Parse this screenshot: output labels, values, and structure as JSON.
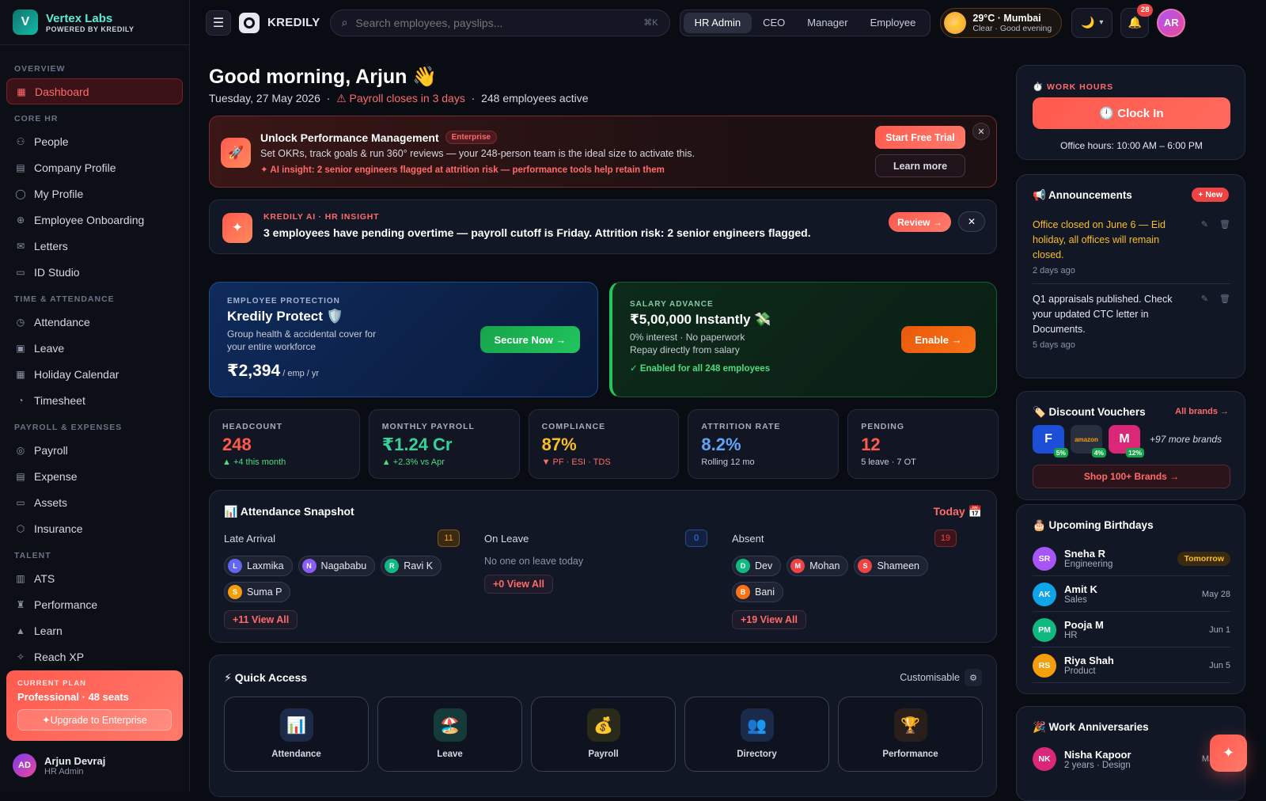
{
  "brand": {
    "initial": "V",
    "name": "Vertex Labs",
    "sub": "POWERED BY KREDILY"
  },
  "sidebar": {
    "sections": [
      {
        "title": "OVERVIEW",
        "items": [
          {
            "label": "Dashboard",
            "icon": "grid-icon",
            "active": true
          }
        ]
      },
      {
        "title": "CORE HR",
        "items": [
          {
            "label": "People",
            "icon": "users-icon"
          },
          {
            "label": "Company Profile",
            "icon": "building-icon"
          },
          {
            "label": "My Profile",
            "icon": "user-icon"
          },
          {
            "label": "Employee Onboarding",
            "icon": "user-plus-icon"
          },
          {
            "label": "Letters",
            "icon": "mail-icon"
          },
          {
            "label": "ID Studio",
            "icon": "id-card-icon"
          }
        ]
      },
      {
        "title": "TIME & ATTENDANCE",
        "items": [
          {
            "label": "Attendance",
            "icon": "clock-icon"
          },
          {
            "label": "Leave",
            "icon": "calendar-check-icon"
          },
          {
            "label": "Holiday Calendar",
            "icon": "calendar-icon"
          },
          {
            "label": "Timesheet",
            "icon": "timer-icon"
          }
        ]
      },
      {
        "title": "PAYROLL & EXPENSES",
        "items": [
          {
            "label": "Payroll",
            "icon": "coin-icon"
          },
          {
            "label": "Expense",
            "icon": "receipt-icon"
          },
          {
            "label": "Assets",
            "icon": "monitor-icon"
          },
          {
            "label": "Insurance",
            "icon": "shield-icon"
          }
        ]
      },
      {
        "title": "TALENT",
        "items": [
          {
            "label": "ATS",
            "icon": "clipboard-icon"
          },
          {
            "label": "Performance",
            "icon": "trophy-icon"
          },
          {
            "label": "Learn",
            "icon": "graduation-icon"
          },
          {
            "label": "Reach XP",
            "icon": "star-icon"
          }
        ]
      }
    ]
  },
  "plan": {
    "label": "CURRENT PLAN",
    "name": "Professional · 48 seats",
    "upgrade": "✦Upgrade to Enterprise"
  },
  "user": {
    "initials": "AD",
    "name": "Arjun Devraj",
    "role": "HR Admin"
  },
  "topbar": {
    "app_name": "KREDILY",
    "search_placeholder": "Search employees, payslips...",
    "search_kbd": "⌘K",
    "roles": [
      {
        "label": "HR Admin",
        "active": true
      },
      {
        "label": "CEO"
      },
      {
        "label": "Manager"
      },
      {
        "label": "Employee"
      }
    ],
    "weather_temp": "29°C · Mumbai",
    "weather_desc": "Clear · Good evening",
    "notif_count": "28",
    "avatar": "AR"
  },
  "greeting": {
    "title": "Good morning, Arjun 👋",
    "date": "Tuesday, 27 May 2026",
    "payroll_warning": "⚠ Payroll closes in 3 days",
    "active": "248 employees active"
  },
  "promo": {
    "title": "Unlock Performance Management",
    "badge": "Enterprise",
    "desc": "Set OKRs, track goals & run 360° reviews — your 248-person team is the ideal size to activate this.",
    "ai": "✦ AI insight: 2 senior engineers flagged at attrition risk — performance tools help retain them",
    "trial": "Start Free Trial",
    "learn": "Learn more"
  },
  "insight": {
    "label": "KREDILY AI · HR INSIGHT",
    "text": "3 employees have pending overtime — payroll cutoff is Friday. Attrition risk: 2 senior engineers flagged.",
    "review": "Review →"
  },
  "protect": {
    "label": "EMPLOYEE PROTECTION",
    "title": "Kredily Protect 🛡️",
    "desc": "Group health & accidental cover for your entire workforce",
    "price": "₹2,394",
    "unit": " / emp / yr",
    "cta": "Secure Now →"
  },
  "advance": {
    "label": "SALARY ADVANCE",
    "title": "₹5,00,000 Instantly 💸",
    "desc1": "0% interest · No paperwork",
    "desc2": "Repay directly from salary",
    "ok": "✓ Enabled for all 248 employees",
    "cta": "Enable →"
  },
  "stats": [
    {
      "label": "HEADCOUNT",
      "value": "248",
      "sub": "▲ +4 this month",
      "color": "#ff5a4e",
      "sub_color": "#4ade80"
    },
    {
      "label": "MONTHLY PAYROLL",
      "value": "₹1.24 Cr",
      "sub": "▲ +2.3% vs Apr",
      "color": "#34d399",
      "sub_color": "#4ade80"
    },
    {
      "label": "COMPLIANCE",
      "value": "87%",
      "sub": "▼ PF · ESI · TDS",
      "color": "#fbbf24",
      "sub_color": "#ff6b6b"
    },
    {
      "label": "ATTRITION RATE",
      "value": "8.2%",
      "sub": "Rolling 12 mo",
      "color": "#60a5fa",
      "sub_color": "#c7ccd6"
    },
    {
      "label": "PENDING",
      "value": "12",
      "sub": "5 leave · 7 OT",
      "color": "#ff5a4e",
      "sub_color": "#c7ccd6"
    }
  ],
  "attendance": {
    "title": "📊 Attendance Snapshot",
    "today": "Today 📅",
    "late": {
      "label": "Late Arrival",
      "count": "11",
      "view": "+11  View All",
      "people": [
        {
          "i": "L",
          "name": "Laxmika",
          "color": "#6366f1"
        },
        {
          "i": "N",
          "name": "Nagababu",
          "color": "#8b5cf6"
        },
        {
          "i": "R",
          "name": "Ravi K",
          "color": "#10b981"
        },
        {
          "i": "S",
          "name": "Suma P",
          "color": "#f59e0b"
        }
      ]
    },
    "leave": {
      "label": "On Leave",
      "count": "0",
      "empty": "No one on leave today",
      "view": "+0  View All"
    },
    "absent": {
      "label": "Absent",
      "count": "19",
      "view": "+19  View All",
      "people": [
        {
          "i": "D",
          "name": "Dev",
          "color": "#10b981"
        },
        {
          "i": "M",
          "name": "Mohan",
          "color": "#ef4444"
        },
        {
          "i": "S",
          "name": "Shameen",
          "color": "#ef4444"
        },
        {
          "i": "B",
          "name": "Bani",
          "color": "#f97316"
        }
      ]
    }
  },
  "quick": {
    "title": "⚡ Quick Access",
    "custom": "Customisable",
    "tiles": [
      {
        "label": "Attendance",
        "icon": "📊",
        "bg": "#1e2a4a"
      },
      {
        "label": "Leave",
        "icon": "🏖️",
        "bg": "#153a3a"
      },
      {
        "label": "Payroll",
        "icon": "💰",
        "bg": "#2a2a1a"
      },
      {
        "label": "Directory",
        "icon": "👥",
        "bg": "#1a2a4a"
      },
      {
        "label": "Performance",
        "icon": "🏆",
        "bg": "#2a1e1a"
      }
    ]
  },
  "work": {
    "label": "⏱️ WORK HOURS",
    "clockin": "🕛 Clock In",
    "hours": "Office hours: 10:00 AM – 6:00 PM"
  },
  "announcements": {
    "title": "📢 Announcements",
    "new": "+ New",
    "items": [
      {
        "text": "Office closed on June 6 — Eid holiday, all offices will remain closed.",
        "time": "2 days ago",
        "color": "#fbbf24"
      },
      {
        "text": "Q1 appraisals published. Check your updated CTC letter in Documents.",
        "time": "5 days ago",
        "color": "#e6e8ef"
      }
    ]
  },
  "vouchers": {
    "title": "🏷️ Discount Vouchers",
    "all": "All brands →",
    "brands": [
      {
        "letter": "F",
        "pct": "5%",
        "bg": "#1d4ed8"
      },
      {
        "letter": "amazon",
        "pct": "4%",
        "bg": "#2a2f3f"
      },
      {
        "letter": "M",
        "pct": "12%",
        "bg": "#db2777"
      }
    ],
    "more": "+97 more brands",
    "shop": "Shop 100+ Brands →"
  },
  "birthdays": {
    "title": "🎂 Upcoming Birthdays",
    "items": [
      {
        "initials": "SR",
        "name": "Sneha R",
        "dept": "Engineering",
        "date": "Tomorrow",
        "color": "#a855f7",
        "tomorrow": true
      },
      {
        "initials": "AK",
        "name": "Amit K",
        "dept": "Sales",
        "date": "May 28",
        "color": "#0ea5e9"
      },
      {
        "initials": "PM",
        "name": "Pooja M",
        "dept": "HR",
        "date": "Jun 1",
        "color": "#10b981"
      },
      {
        "initials": "RS",
        "name": "Riya Shah",
        "dept": "Product",
        "date": "Jun 5",
        "color": "#f59e0b"
      }
    ]
  },
  "anniversaries": {
    "title": "🎉 Work Anniversaries",
    "items": [
      {
        "initials": "NK",
        "name": "Nisha Kapoor",
        "dept": "2 years · Design",
        "date": "May 30",
        "color": "#db2777"
      }
    ]
  }
}
